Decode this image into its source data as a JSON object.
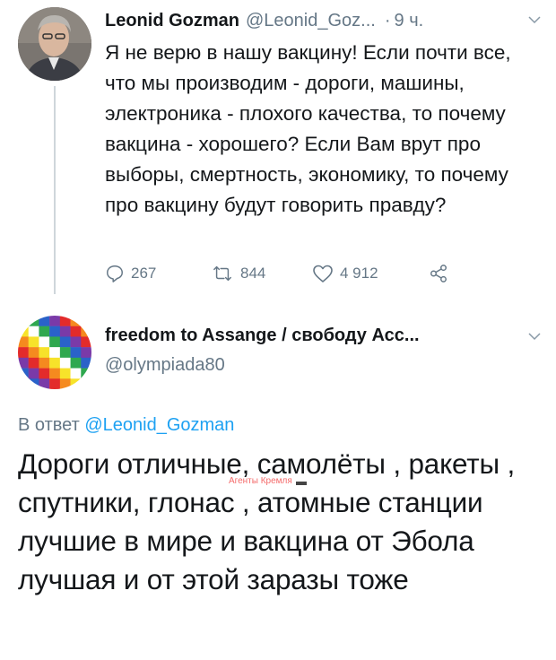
{
  "tweet1": {
    "display_name": "Leonid Gozman",
    "handle": "@Leonid_Goz...",
    "separator": "·",
    "time": "9 ч.",
    "text": "Я не верю в нашу вакцину! Если почти все, что мы производим - дороги, машины, электроника - плохого качества, то почему вакцина - хорошего? Если Вам врут про выборы, смертность, экономику, то почему про вакцину будут говорить правду?",
    "actions": {
      "replies": "267",
      "retweets": "844",
      "likes": "4 912"
    },
    "icons": [
      "reply-icon",
      "retweet-icon",
      "like-icon",
      "share-icon",
      "chevron-down-icon"
    ]
  },
  "tweet2": {
    "display_name": "freedom to Assange / свободу Асс...",
    "handle": "@olympiada80",
    "reply_prefix": "В ответ",
    "reply_to": "@Leonid_Gozman",
    "text": "Дороги отличные, самолёты , ракеты , спутники, глонас , атомные станции лучшие в мире и вакцина от Эбола лучшая и от этой заразы тоже"
  },
  "watermark": "Агенты Кремля",
  "colors": {
    "text": "#14171a",
    "secondary": "#657786",
    "link": "#1da1f2",
    "watermark": "#f46a6a"
  }
}
